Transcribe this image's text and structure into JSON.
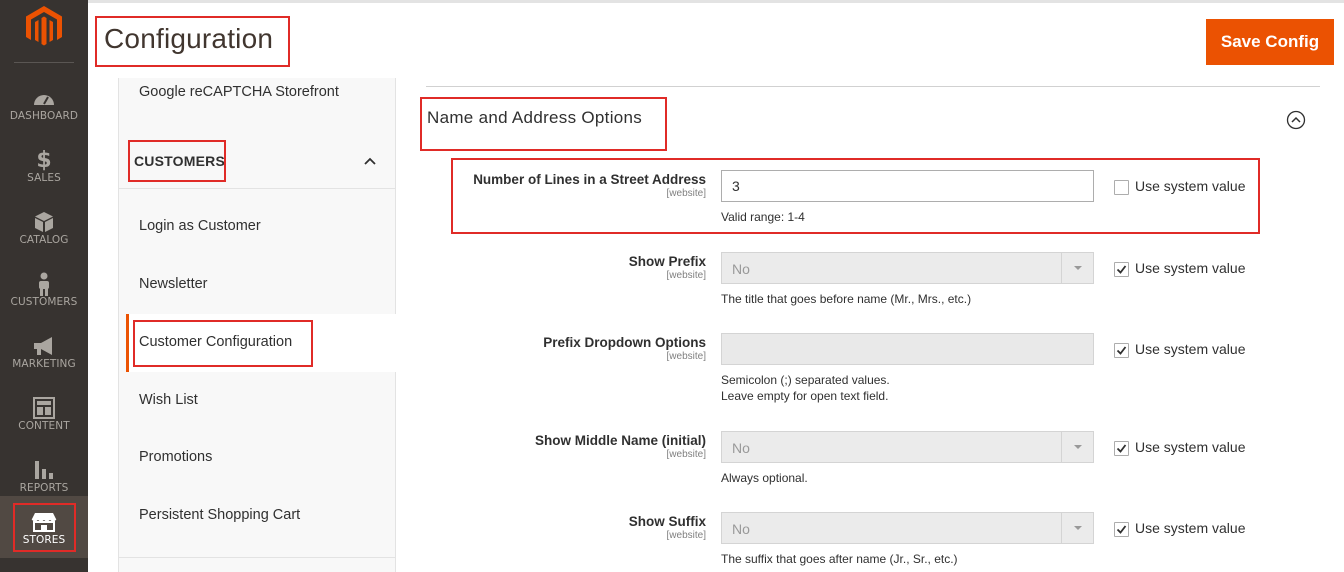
{
  "menu": {
    "items": [
      {
        "label": "DASHBOARD",
        "icon": "dashboard-icon"
      },
      {
        "label": "SALES",
        "icon": "dollar-icon"
      },
      {
        "label": "CATALOG",
        "icon": "box-icon"
      },
      {
        "label": "CUSTOMERS",
        "icon": "person-icon"
      },
      {
        "label": "MARKETING",
        "icon": "megaphone-icon"
      },
      {
        "label": "CONTENT",
        "icon": "layout-icon"
      },
      {
        "label": "REPORTS",
        "icon": "bar-chart-icon"
      },
      {
        "label": "STORES",
        "icon": "storefront-icon"
      }
    ],
    "active": "STORES"
  },
  "header": {
    "title": "Configuration",
    "save_label": "Save Config"
  },
  "tabs": {
    "above_item": "Google reCAPTCHA Storefront",
    "group_label": "CUSTOMERS",
    "items": [
      "Login as Customer",
      "Newsletter",
      "Customer Configuration",
      "Wish List",
      "Promotions",
      "Persistent Shopping Cart"
    ],
    "active": "Customer Configuration"
  },
  "section": {
    "title": "Name and Address Options",
    "fields": [
      {
        "label": "Number of Lines in a Street Address",
        "scope": "[website]",
        "value": "3",
        "note": "Valid range: 1-4",
        "use_system": false,
        "system_label": "Use system value"
      },
      {
        "label": "Show Prefix",
        "scope": "[website]",
        "value": "No",
        "note": "The title that goes before name (Mr., Mrs., etc.)",
        "use_system": true,
        "system_label": "Use system value"
      },
      {
        "label": "Prefix Dropdown Options",
        "scope": "[website]",
        "value": "",
        "note_line1": "Semicolon (;) separated values.",
        "note_line2": "Leave empty for open text field.",
        "use_system": true,
        "system_label": "Use system value"
      },
      {
        "label": "Show Middle Name (initial)",
        "scope": "[website]",
        "value": "No",
        "note": "Always optional.",
        "use_system": true,
        "system_label": "Use system value"
      },
      {
        "label": "Show Suffix",
        "scope": "[website]",
        "value": "No",
        "note": "The suffix that goes after name (Jr., Sr., etc.)",
        "use_system": true,
        "system_label": "Use system value"
      }
    ]
  },
  "colors": {
    "accent": "#eb5202",
    "highlight": "#e02b27",
    "menu_bg": "#373330"
  }
}
